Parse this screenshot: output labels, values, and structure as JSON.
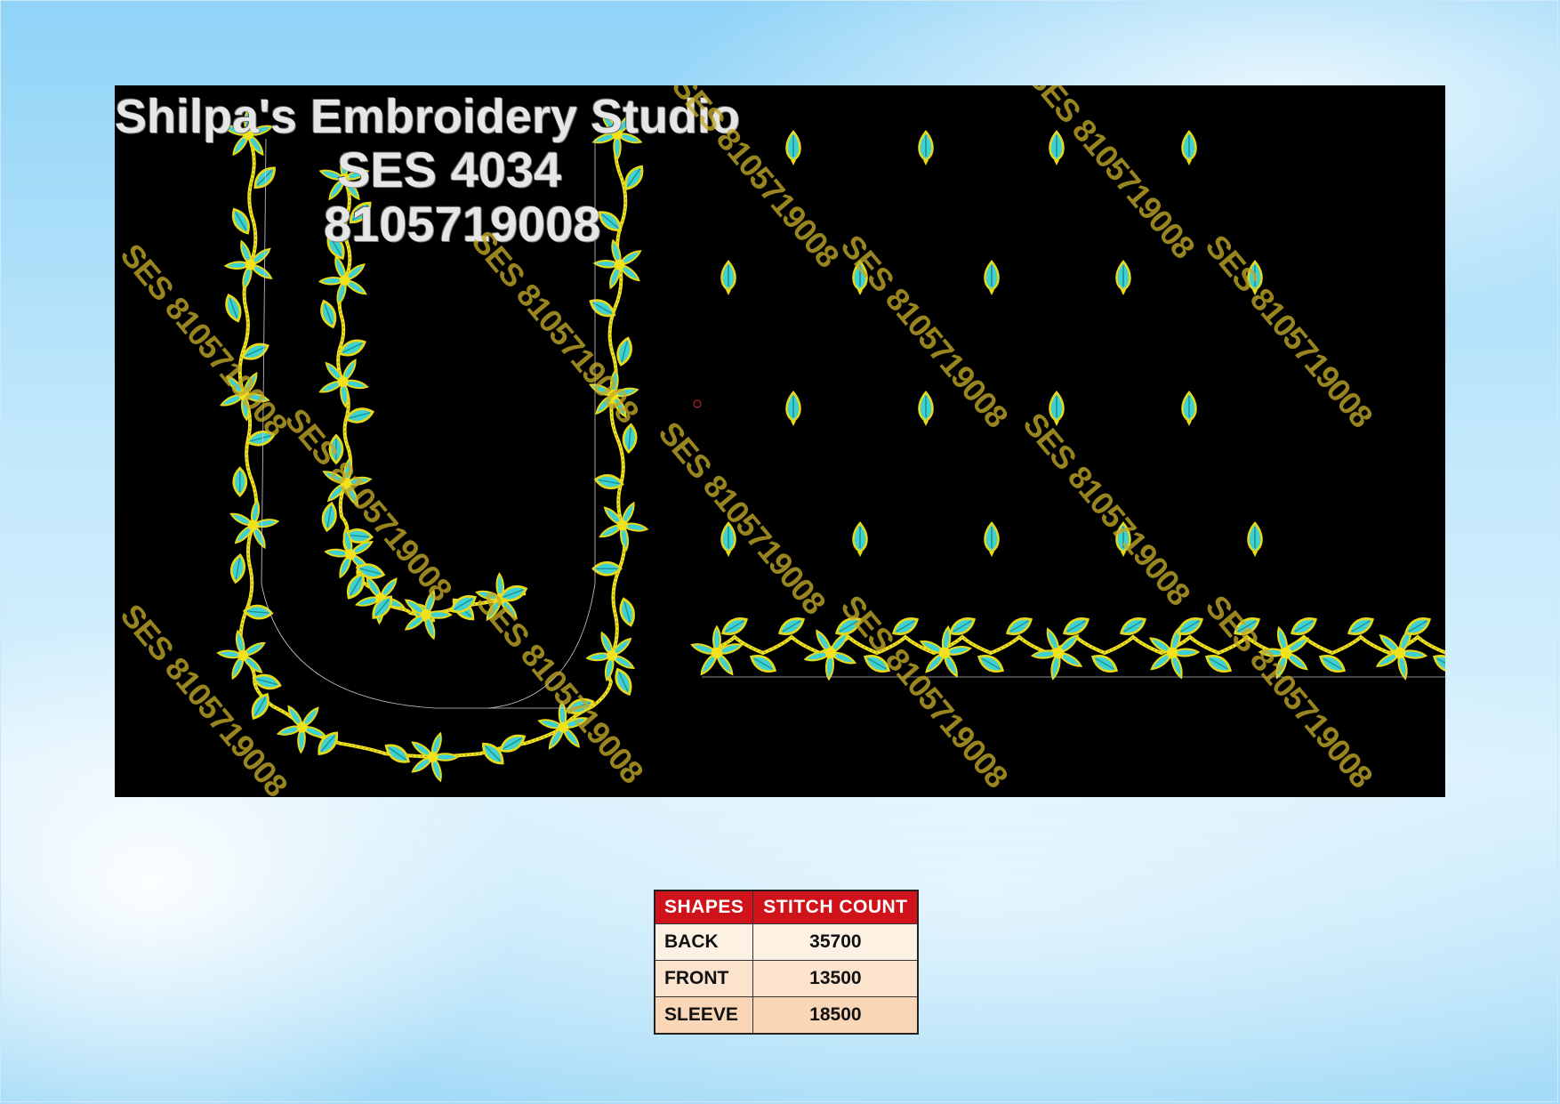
{
  "header": {
    "studio_name": "Shilpa's  Embroidery  Studio",
    "design_code": "SES  4034",
    "phone": "8105719008"
  },
  "watermark_text": "SES 8105719008",
  "colors": {
    "background_black": "#000000",
    "thread_cyan": "#3ed1d0",
    "thread_yellow": "#f2e21c",
    "table_header_red": "#d0121a"
  },
  "stitch_table": {
    "headers": [
      "SHAPES",
      "STITCH COUNT"
    ],
    "rows": [
      {
        "shape": "BACK",
        "count": "35700"
      },
      {
        "shape": "FRONT",
        "count": "13500"
      },
      {
        "shape": "SLEEVE",
        "count": "18500"
      }
    ]
  }
}
